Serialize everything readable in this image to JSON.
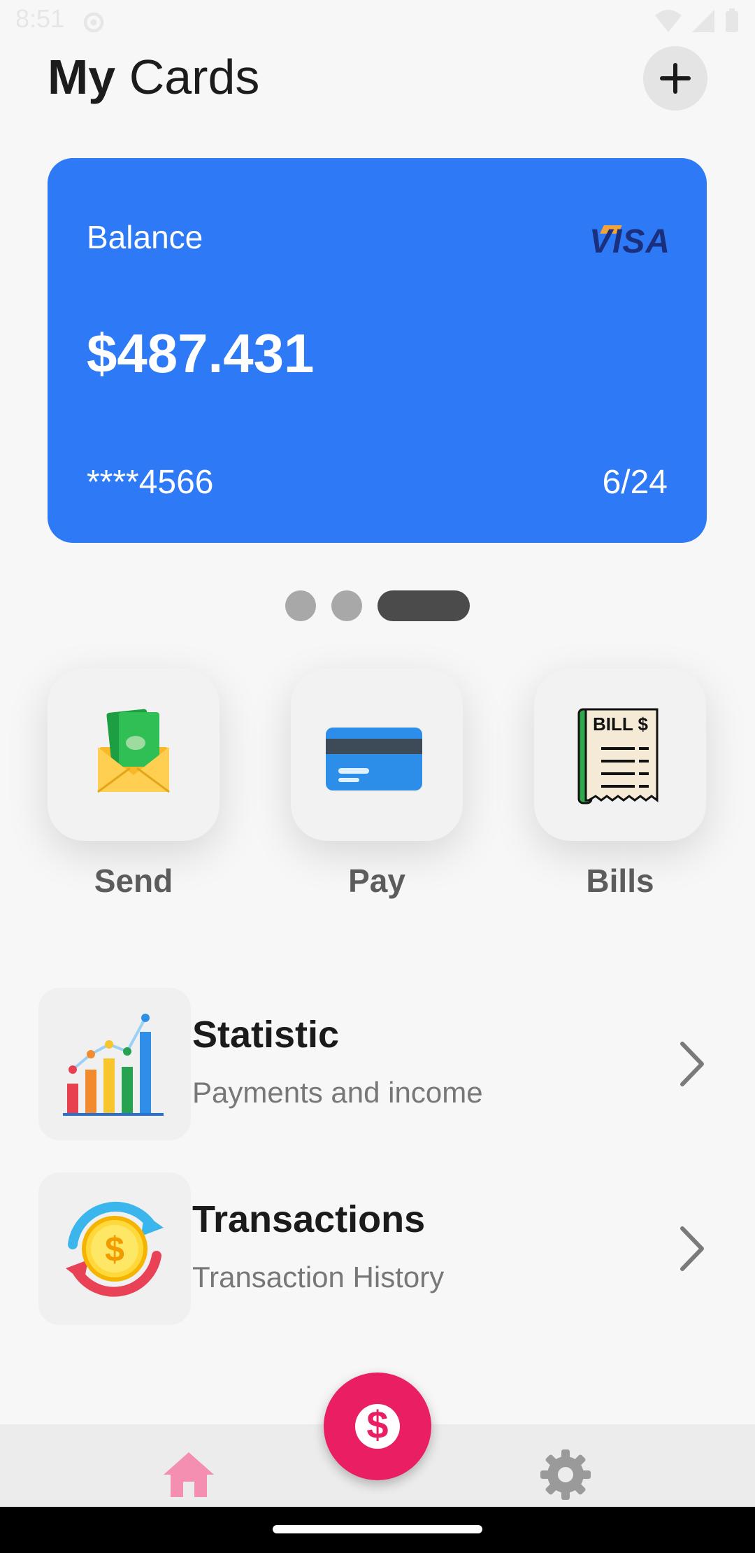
{
  "status_bar": {
    "time": "8:51"
  },
  "header": {
    "title_bold": "My",
    "title_rest": " Cards"
  },
  "card": {
    "balance_label": "Balance",
    "balance": "$487.431",
    "brand": "VISA",
    "number": "****4566",
    "expiry": "6/24",
    "color": "#2d79f6"
  },
  "pager": {
    "count": 3,
    "active_index": 2
  },
  "actions": [
    {
      "label": "Send",
      "icon": "money-envelope-icon"
    },
    {
      "label": "Pay",
      "icon": "credit-card-icon"
    },
    {
      "label": "Bills",
      "icon": "bill-receipt-icon",
      "icon_text": "BILL $"
    }
  ],
  "list": [
    {
      "title": "Statistic",
      "subtitle": "Payments and income",
      "icon": "bar-chart-icon"
    },
    {
      "title": "Transactions",
      "subtitle": "Transaction History",
      "icon": "coin-exchange-icon",
      "icon_text": "$"
    }
  ],
  "bottom_nav": {
    "items": [
      "home-icon",
      "settings-icon"
    ],
    "fab_symbol": "$",
    "accent": "#e91e63"
  }
}
